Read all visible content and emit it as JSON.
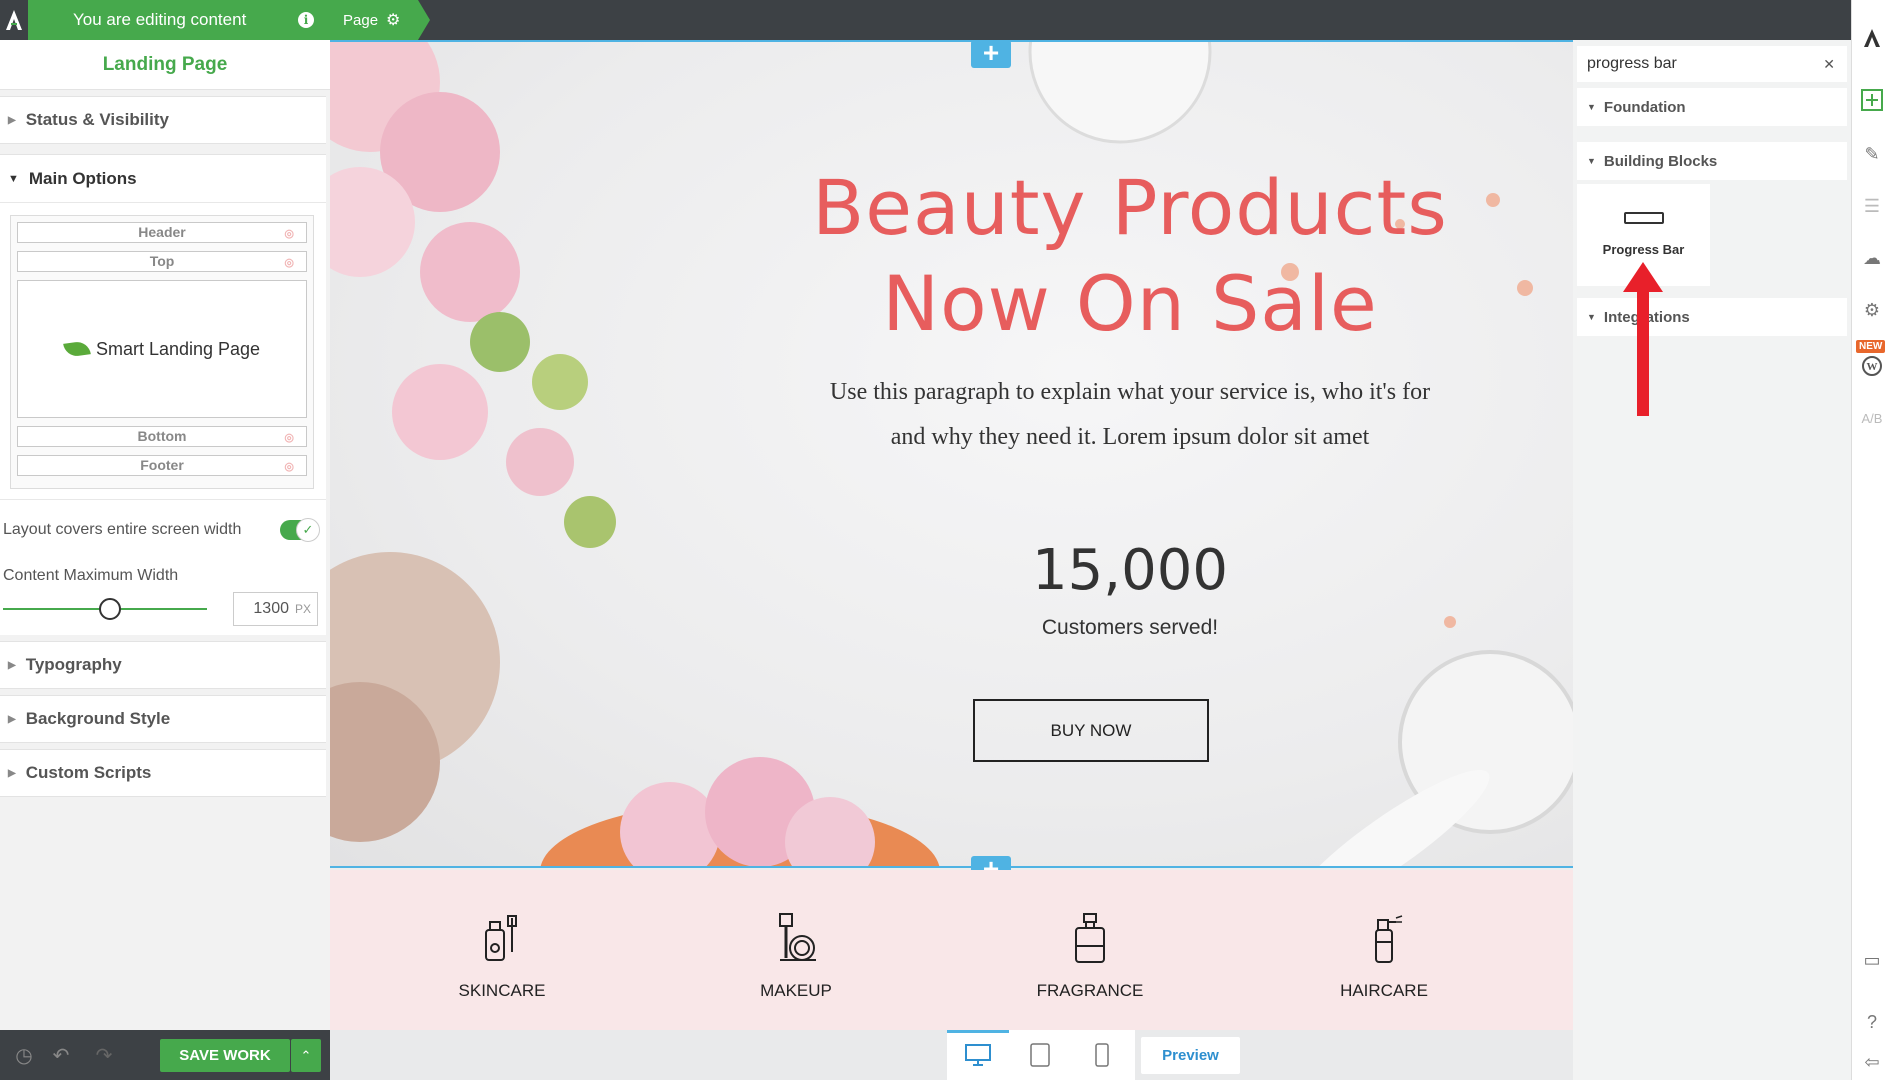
{
  "topbar": {
    "editing_label": "You are editing content",
    "page_tab_label": "Page"
  },
  "left_panel": {
    "title": "Landing Page",
    "sections": {
      "status": "Status & Visibility",
      "main_options": "Main Options",
      "typography": "Typography",
      "background": "Background Style",
      "scripts": "Custom Scripts"
    },
    "layout_slots": {
      "header": "Header",
      "top": "Top",
      "content": "Smart Landing Page",
      "bottom": "Bottom",
      "footer": "Footer"
    },
    "full_width_label": "Layout covers entire screen width",
    "full_width_enabled": true,
    "max_width_label": "Content Maximum Width",
    "max_width_value": "1300",
    "max_width_unit": "PX"
  },
  "bottom_bar": {
    "save_label": "SAVE WORK"
  },
  "canvas": {
    "title_line1": "Beauty Products",
    "title_line2": "Now On Sale",
    "paragraph_line1": "Use this paragraph to explain what your service is, who it's for",
    "paragraph_line2": "and why they need it. Lorem ipsum dolor sit amet",
    "stat_number": "15,000",
    "stat_label": "Customers served!",
    "cta_label": "BUY NOW",
    "categories": [
      "SKINCARE",
      "MAKEUP",
      "FRAGRANCE",
      "HAIRCARE"
    ]
  },
  "device_bar": {
    "preview_label": "Preview"
  },
  "right_panel": {
    "search_value": "progress bar",
    "groups": {
      "foundation": "Foundation",
      "building_blocks": "Building Blocks",
      "integrations": "Integrations"
    },
    "tile_label": "Progress Bar"
  },
  "rail": {
    "new_badge": "NEW"
  },
  "colors": {
    "brand_green": "#46a94c",
    "accent_blue": "#4fb3e3",
    "title_red": "#e75d5d",
    "arrow_red": "#e8202a"
  }
}
